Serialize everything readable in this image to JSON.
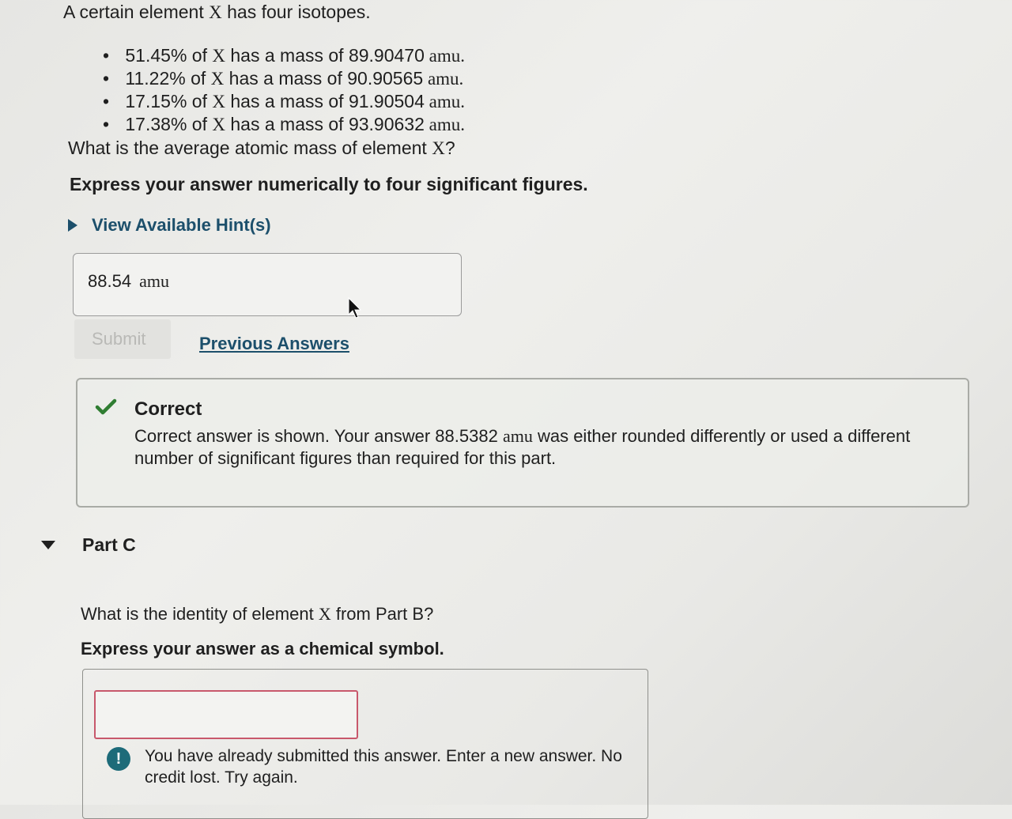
{
  "problem": {
    "intro_pre": "A certain element ",
    "intro_var": "X",
    "intro_post": " has four isotopes.",
    "isotopes": [
      {
        "percent": "51.45% of ",
        "var": "X",
        "mid": " has a mass of ",
        "mass": "89.90470",
        "unit": " amu."
      },
      {
        "percent": "11.22% of ",
        "var": "X",
        "mid": " has a mass of ",
        "mass": "90.90565",
        "unit": " amu."
      },
      {
        "percent": "17.15% of ",
        "var": "X",
        "mid": " has a mass of ",
        "mass": "91.90504",
        "unit": " amu."
      },
      {
        "percent": "17.38% of ",
        "var": "X",
        "mid": " has a mass of ",
        "mass": "93.90632",
        "unit": " amu."
      }
    ],
    "question_pre": "What is the average atomic mass of element ",
    "question_var": "X",
    "question_post": "?",
    "instruction": "Express your answer numerically to four significant figures.",
    "hint_label": "View Available Hint(s)"
  },
  "answer": {
    "value": "88.54",
    "unit": "amu"
  },
  "buttons": {
    "submit": "Submit",
    "previous_answers": "Previous Answers"
  },
  "feedback": {
    "title": "Correct",
    "msg_pre": "Correct answer is shown. Your answer ",
    "msg_value": "88.5382",
    "msg_unit": "amu",
    "msg_post": " was either rounded differently or used a different number of significant figures than required for this part."
  },
  "part_c": {
    "label": "Part C",
    "question_pre": "What is the identity of element ",
    "question_var": "X",
    "question_post": " from Part B?",
    "instruction": "Express your answer as a chemical symbol.",
    "input_value": "",
    "warning": "You have already submitted this answer. Enter a new answer. No credit lost. Try again."
  },
  "colors": {
    "link": "#1c4f6b",
    "check": "#2f7d32",
    "warning_icon": "#1d6b79",
    "error_border": "#c8586c"
  }
}
